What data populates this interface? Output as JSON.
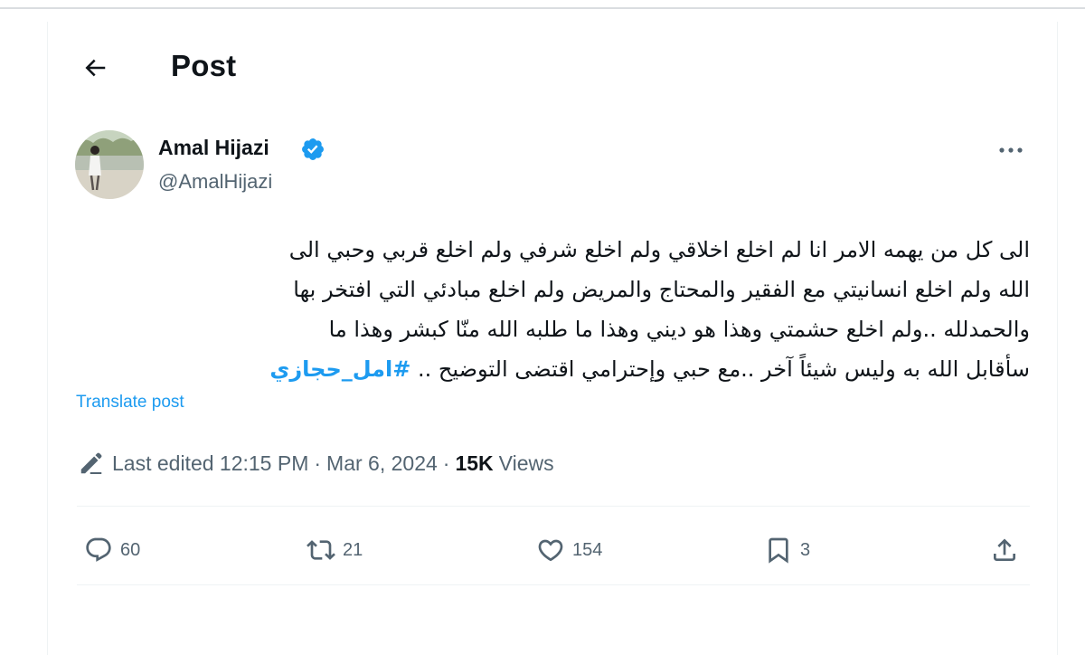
{
  "header": {
    "title": "Post"
  },
  "author": {
    "name": "Amal Hijazi",
    "handle": "@AmalHijazi",
    "verified": true
  },
  "post": {
    "lines": [
      "الى كل من يهمه الامر  انا لم اخلع اخلاقي ولم اخلع شرفي ولم اخلع قربي وحبي الى",
      "الله ولم اخلع انسانيتي مع الفقير والمحتاج والمريض ولم اخلع مبادئي التي افتخر بها",
      "والحمدلله ..ولم اخلع حشمتي وهذا هو ديني وهذا ما طلبه الله منّا كبشر وهذا ما"
    ],
    "last_line_text": "سأقابل الله به وليس شيئاً آخر ..مع حبي وإحترامي اقتضى التوضيح .. ",
    "hashtag": "#امل_حجازي",
    "translate_label": "Translate post"
  },
  "meta": {
    "edited_label": "Last edited 12:15 PM",
    "separator": "·",
    "date": "Mar 6, 2024",
    "views_count": "15K",
    "views_label": "Views"
  },
  "actions": {
    "replies": "60",
    "reposts": "21",
    "likes": "154",
    "bookmarks": "3"
  },
  "icons": {
    "back": "arrow-left-icon",
    "verified": "verified-badge-icon",
    "more": "more-horizontal-icon",
    "edit": "pencil-icon",
    "reply": "reply-icon",
    "repost": "repost-icon",
    "like": "heart-icon",
    "bookmark": "bookmark-icon",
    "share": "share-icon"
  },
  "colors": {
    "accent": "#1d9bf0",
    "text": "#0f1419",
    "secondary": "#536471",
    "border": "#eff3f4"
  }
}
